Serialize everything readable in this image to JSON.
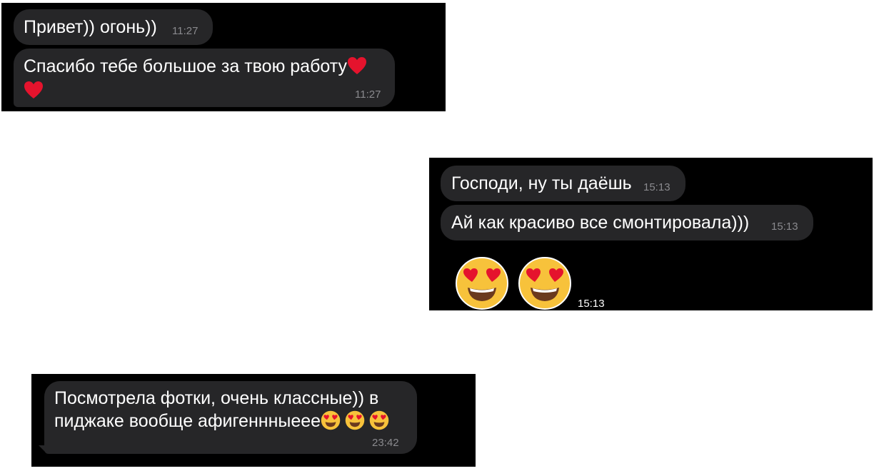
{
  "colors": {
    "panel_bg": "#000000",
    "bubble_bg": "#262628",
    "text": "#ffffff",
    "timestamp": "#8a8a8e",
    "heart": "#e5132d",
    "emoji_face": "#f7c23b"
  },
  "chat1": {
    "messages": [
      {
        "text": "Привет)) огонь))",
        "time": "11:27"
      },
      {
        "line1": "Спасибо тебе большое за твою работу",
        "time": "11:27",
        "emoji": [
          "heart-emoji",
          "heart-emoji"
        ]
      }
    ]
  },
  "chat2": {
    "messages": [
      {
        "text": "Господи, ну ты даёшь",
        "time": "15:13"
      },
      {
        "text": "Ай как красиво все смонтировала)))",
        "time": "15:13"
      }
    ],
    "sticker": {
      "emoji": [
        "heart-eyes-emoji",
        "heart-eyes-emoji"
      ],
      "time": "15:13"
    }
  },
  "chat3": {
    "messages": [
      {
        "line1": "Посмотрела фотки, очень классные)) в",
        "line2": "пиджаке вообще афигеннныеее",
        "time": "23:42",
        "emoji": [
          "heart-eyes-emoji",
          "heart-eyes-emoji",
          "heart-eyes-emoji"
        ]
      }
    ]
  }
}
